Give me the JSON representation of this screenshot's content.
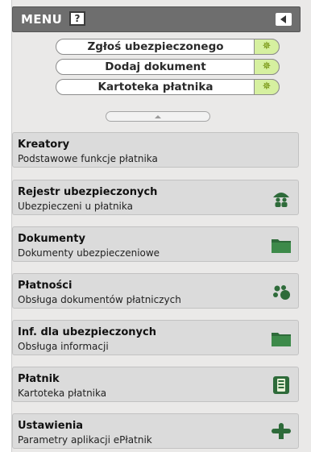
{
  "menu": {
    "title": "MENU",
    "help_label": "?"
  },
  "quick_actions": [
    {
      "label": "Zgłoś ubezpieczonego",
      "icon": "gear-star-icon"
    },
    {
      "label": "Dodaj dokument",
      "icon": "gear-star-icon"
    },
    {
      "label": "Kartoteka płatnika",
      "icon": "gear-star-icon"
    }
  ],
  "nav_items": [
    {
      "title": "Kreatory",
      "subtitle": "Podstawowe funkcje płatnika",
      "icon": ""
    },
    {
      "title": "Rejestr ubezpieczonych",
      "subtitle": "Ubezpieczeni u płatnika",
      "icon": "people-umbrella-icon"
    },
    {
      "title": "Dokumenty",
      "subtitle": "Dokumenty ubezpieczeniowe",
      "icon": "folder-icon"
    },
    {
      "title": "Płatności",
      "subtitle": "Obsługa dokumentów płatniczych",
      "icon": "coins-icon"
    },
    {
      "title": "Inf. dla ubezpieczonych",
      "subtitle": "Obsługa informacji",
      "icon": "folder-icon"
    },
    {
      "title": "Płatnik",
      "subtitle": "Kartoteka płatnika",
      "icon": "card-file-icon"
    },
    {
      "title": "Ustawienia",
      "subtitle": "Parametry aplikacji ePłatnik",
      "icon": "puzzle-icon"
    }
  ],
  "colors": {
    "icon_green": "#2e6b3a",
    "quick_icon_bg": "#d6f0a0",
    "header_bg": "#6e6e6e"
  }
}
